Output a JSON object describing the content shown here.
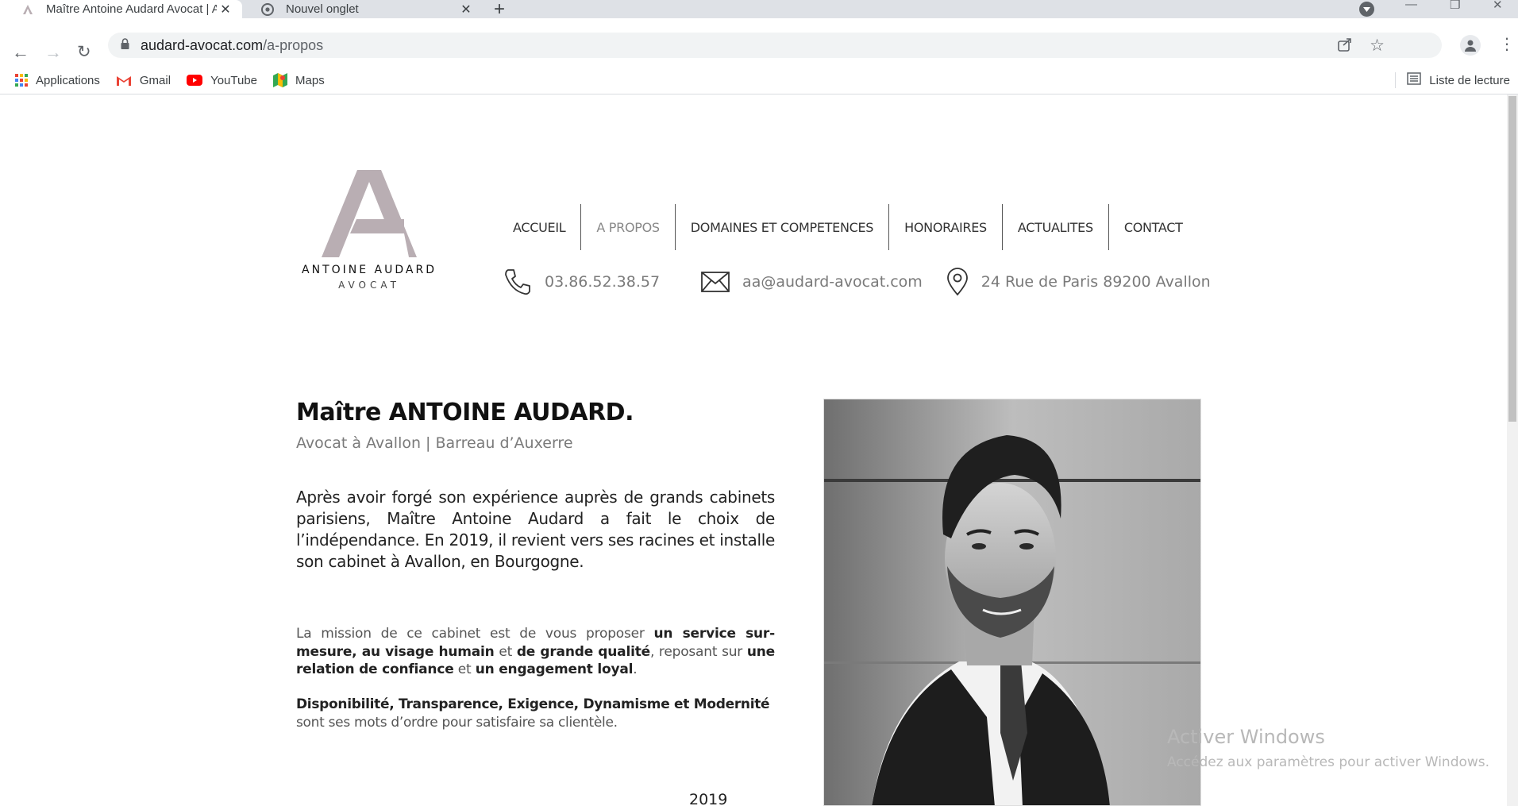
{
  "browser": {
    "tabs": [
      {
        "title": "Maître Antoine Audard Avocat | A",
        "active": true
      },
      {
        "title": "Nouvel onglet",
        "active": false
      }
    ],
    "url_host": "audard-avocat.com",
    "url_path": "/a-propos",
    "bookmarks": [
      {
        "label": "Applications",
        "icon": "apps-grid-icon"
      },
      {
        "label": "Gmail",
        "icon": "gmail-icon"
      },
      {
        "label": "YouTube",
        "icon": "youtube-icon"
      },
      {
        "label": "Maps",
        "icon": "maps-icon"
      }
    ],
    "reading_list": "Liste de lecture"
  },
  "site": {
    "logo": {
      "name": "ANTOINE AUDARD",
      "sub": "AVOCAT"
    },
    "nav": [
      {
        "label": "ACCUEIL",
        "active": false
      },
      {
        "label": "A PROPOS",
        "active": true
      },
      {
        "label": "DOMAINES ET COMPETENCES",
        "active": false
      },
      {
        "label": "HONORAIRES",
        "active": false
      },
      {
        "label": "ACTUALITES",
        "active": false
      },
      {
        "label": "CONTACT",
        "active": false
      }
    ],
    "contact": {
      "phone": "03.86.52.38.57",
      "email": "aa@audard-avocat.com",
      "address": "24 Rue de Paris 89200 Avallon"
    }
  },
  "content": {
    "headline": "Maître ANTOINE AUDARD.",
    "subhead": "Avocat à Avallon | Barreau d’Auxerre",
    "intro": "Après avoir forgé son expérience auprès de grands cabinets parisiens, Maître Antoine Audard a fait le choix de l’indépendance. En 2019, il revient vers ses racines et installe son cabinet à Avallon, en Bourgogne.",
    "mission": [
      {
        "t": "La mission de ce cabinet est de vous proposer ",
        "b": false
      },
      {
        "t": "un service sur-mesure, au visage humain",
        "b": true
      },
      {
        "t": " et ",
        "b": false
      },
      {
        "t": "de grande qualité",
        "b": true
      },
      {
        "t": ", reposant sur ",
        "b": false
      },
      {
        "t": "une relation de confiance",
        "b": true
      },
      {
        "t": " et ",
        "b": false
      },
      {
        "t": "un engagement loyal",
        "b": true
      },
      {
        "t": ".",
        "b": false
      }
    ],
    "values_bold": "Disponibilité, Transparence, Exigence, Dynamisme et Modernité",
    "values_rest": "sont ses mots d’ordre pour satisfaire sa clientèle.",
    "year": "2019"
  },
  "watermark": {
    "title": "Activer Windows",
    "sub": "Accédez aux paramètres pour activer Windows."
  }
}
